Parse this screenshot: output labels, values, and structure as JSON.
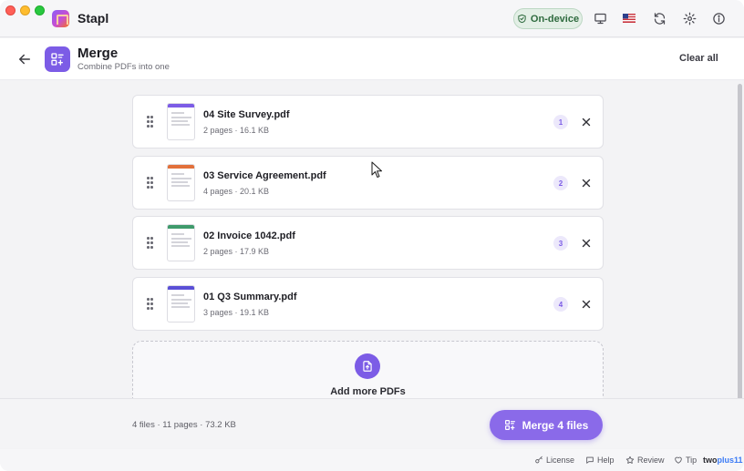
{
  "app": {
    "name": "Stapl"
  },
  "titlebar": {
    "on_device_label": "On-device",
    "icons": [
      "monitor-icon",
      "us-flag-icon",
      "refresh-icon",
      "gear-icon",
      "info-icon"
    ]
  },
  "header": {
    "title": "Merge",
    "subtitle": "Combine PDFs into one",
    "clear_all_label": "Clear all"
  },
  "files": [
    {
      "name": "04 Site Survey.pdf",
      "meta": "2 pages · 16.1 KB",
      "order": "1",
      "thumb_color": "#7c5ce6"
    },
    {
      "name": "03 Service Agreement.pdf",
      "meta": "4 pages · 20.1 KB",
      "order": "2",
      "thumb_color": "#e2703a"
    },
    {
      "name": "02 Invoice 1042.pdf",
      "meta": "2 pages · 17.9 KB",
      "order": "3",
      "thumb_color": "#3f9a6b"
    },
    {
      "name": "01 Q3 Summary.pdf",
      "meta": "3 pages · 19.1 KB",
      "order": "4",
      "thumb_color": "#5a4fd6"
    }
  ],
  "add_more": {
    "label": "Add more PDFs"
  },
  "footer": {
    "summary": "4 files · 11 pages · 73.2 KB",
    "merge_label": "Merge 4 files"
  },
  "statusbar": {
    "license": "License",
    "help": "Help",
    "review": "Review",
    "tip": "Tip",
    "brand_part1": "two",
    "brand_part2": "plus11"
  },
  "colors": {
    "accent": "#7c5ce6",
    "on_device_green": "#2f6b3f"
  }
}
